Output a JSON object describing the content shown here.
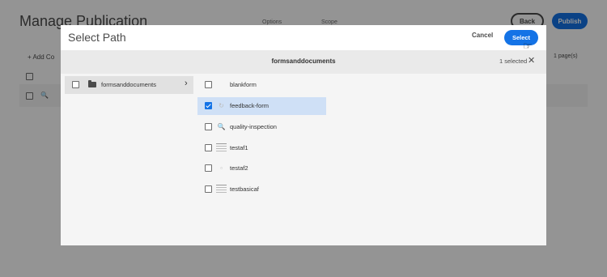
{
  "background": {
    "title": "Manage Publication",
    "tabs": [
      "Options",
      "Scope"
    ],
    "back_label": "Back",
    "publish_label": "Publish",
    "add_label": "Add Co",
    "pages_label": "1 page(s)"
  },
  "dialog": {
    "title": "Select Path",
    "cancel_label": "Cancel",
    "select_label": "Select",
    "current_path": "formsanddocuments",
    "selected_count": "1 selected",
    "column1": {
      "label": "formsanddocuments",
      "icon": "folder-icon"
    },
    "items": [
      {
        "label": "blankform",
        "icon": "blank-icon",
        "checked": false,
        "selected": false
      },
      {
        "label": "feedback-form",
        "icon": "form-icon",
        "checked": true,
        "selected": true
      },
      {
        "label": "quality-inspection",
        "icon": "search-icon",
        "checked": false,
        "selected": false
      },
      {
        "label": "testaf1",
        "icon": "doc-icon",
        "checked": false,
        "selected": false
      },
      {
        "label": "testaf2",
        "icon": "form-icon",
        "checked": false,
        "selected": false
      },
      {
        "label": "testbasicaf",
        "icon": "doc-icon",
        "checked": false,
        "selected": false
      }
    ]
  },
  "colors": {
    "accent": "#1473e6",
    "selected_row": "#cfe0f6"
  }
}
